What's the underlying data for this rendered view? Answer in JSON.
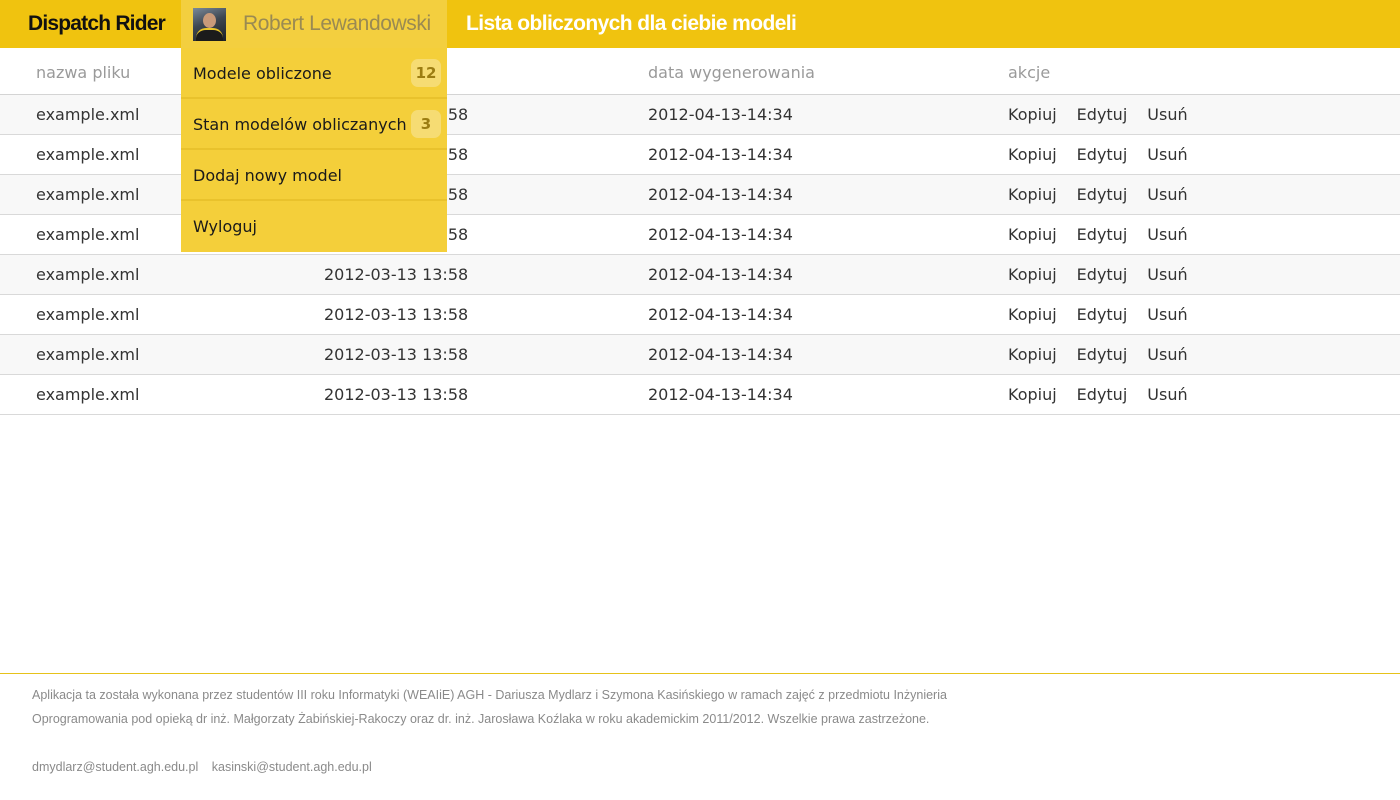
{
  "header": {
    "brand": "Dispatch Rider",
    "user_name": "Robert Lewandowski",
    "page_title": "Lista obliczonych dla ciebie modeli",
    "accent_color": "#f0c30f"
  },
  "menu": {
    "items": [
      {
        "label": "Modele obliczone",
        "badge": "12"
      },
      {
        "label": "Stan modelów obliczanych",
        "badge": "3"
      },
      {
        "label": "Dodaj nowy model"
      },
      {
        "label": "Wyloguj"
      }
    ]
  },
  "table": {
    "headers": [
      "nazwa pliku",
      "",
      "data wygenerowania",
      "akcje"
    ],
    "actions": [
      "Kopiuj",
      "Edytuj",
      "Usuń"
    ],
    "rows": [
      {
        "file": "example.xml",
        "created": "2012-03-13 13:58",
        "generated": "2012-04-13-14:34"
      },
      {
        "file": "example.xml",
        "created": "2012-03-13 13:58",
        "generated": "2012-04-13-14:34"
      },
      {
        "file": "example.xml",
        "created": "2012-03-13 13:58",
        "generated": "2012-04-13-14:34"
      },
      {
        "file": "example.xml",
        "created": "2012-03-13 13:58",
        "generated": "2012-04-13-14:34"
      },
      {
        "file": "example.xml",
        "created": "2012-03-13 13:58",
        "generated": "2012-04-13-14:34"
      },
      {
        "file": "example.xml",
        "created": "2012-03-13 13:58",
        "generated": "2012-04-13-14:34"
      },
      {
        "file": "example.xml",
        "created": "2012-03-13 13:58",
        "generated": "2012-04-13-14:34"
      },
      {
        "file": "example.xml",
        "created": "2012-03-13 13:58",
        "generated": "2012-04-13-14:34"
      }
    ]
  },
  "footer": {
    "line1": "Aplikacja ta została wykonana przez studentów III roku Informatyki  (WEAIiE) AGH - Dariusza Mydlarz i Szymona Kasińskiego w ramach zajęć z przedmiotu Inżynieria",
    "line2": "Oprogramowania pod opieką dr inż.  Małgorzaty Żabińskiej-Rakoczy oraz dr. inż. Jarosława Koźlaka w roku akademickim 2011/2012. Wszelkie prawa zastrzeżone.",
    "emails": [
      "dmydlarz@student.agh.edu.pl",
      "kasinski@student.agh.edu.pl"
    ]
  }
}
